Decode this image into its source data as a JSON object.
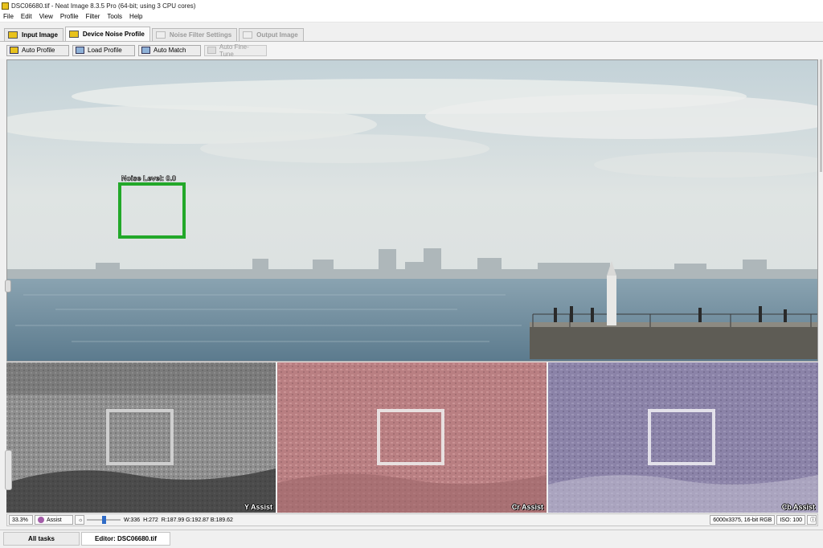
{
  "window": {
    "title": "DSC06680.tif - Neat Image 8.3.5 Pro (64-bit; using 3 CPU cores)"
  },
  "menu": [
    "File",
    "Edit",
    "View",
    "Profile",
    "Filter",
    "Tools",
    "Help"
  ],
  "tabs": [
    {
      "label": "Input Image",
      "state": "normal"
    },
    {
      "label": "Device Noise Profile",
      "state": "active"
    },
    {
      "label": "Noise Filter Settings",
      "state": "disabled"
    },
    {
      "label": "Output Image",
      "state": "disabled"
    }
  ],
  "toolbar": {
    "auto_profile": "Auto Profile",
    "load_profile": "Load Profile",
    "auto_match": "Auto Match",
    "auto_fine_tune": "Auto Fine-Tune"
  },
  "viewer": {
    "noise_level_label": "Noise Level: 0.0"
  },
  "assist": {
    "y_label": "Y Assist",
    "cr_label": "Cr Assist",
    "cb_label": "Cb Assist"
  },
  "status": {
    "zoom": "33.3%",
    "mode": "Assist",
    "width": "W:336",
    "height": "H:272",
    "rgb": "R:187.99 G:192.87 B:189.62",
    "image_info": "6000x3375, 16-bit RGB",
    "iso": "ISO: 100"
  },
  "bottom_tabs": {
    "all_tasks": "All tasks",
    "editor": "Editor: DSC06680.tif"
  },
  "colors": {
    "selection": "#22a829",
    "sea": "#6f8ea2",
    "sky": "#d6dde0"
  }
}
